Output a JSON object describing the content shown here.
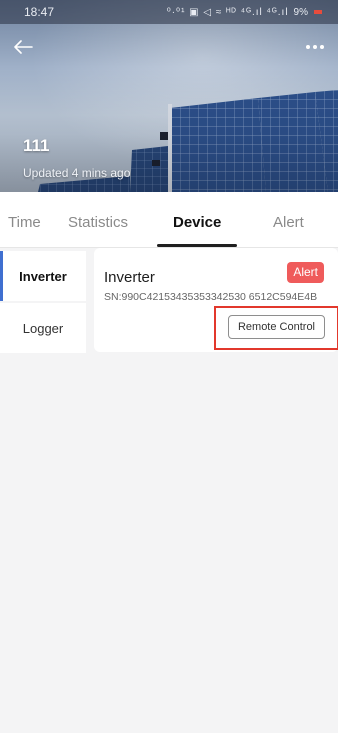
{
  "status_bar": {
    "time": "18:47",
    "indicators": "⁰·⁰¹ ▣ ◁ ≈ ᴴᴰ ⁴ᴳ.ıl ⁴ᴳ.ıl",
    "battery": "9%"
  },
  "header": {
    "plant_name": "111",
    "updated": "Updated 4 mins ago",
    "back_icon": "back-arrow-icon",
    "more_icon": "more-dots-icon"
  },
  "tabs": [
    {
      "label": "Time",
      "active": false
    },
    {
      "label": "Statistics",
      "active": false
    },
    {
      "label": "Device",
      "active": true
    },
    {
      "label": "Alert",
      "active": false
    }
  ],
  "sidebar": {
    "items": [
      {
        "label": "Inverter",
        "active": true
      },
      {
        "label": "Logger",
        "active": false
      }
    ]
  },
  "device": {
    "name": "Inverter",
    "sn": "SN:990C42153435353342530 6512C594E4B",
    "alert_label": "Alert",
    "remote_label": "Remote Control"
  },
  "colors": {
    "accent_blue": "#3f6fd0",
    "alert_red": "#ef5b5b",
    "highlight_red": "#e2382c"
  }
}
